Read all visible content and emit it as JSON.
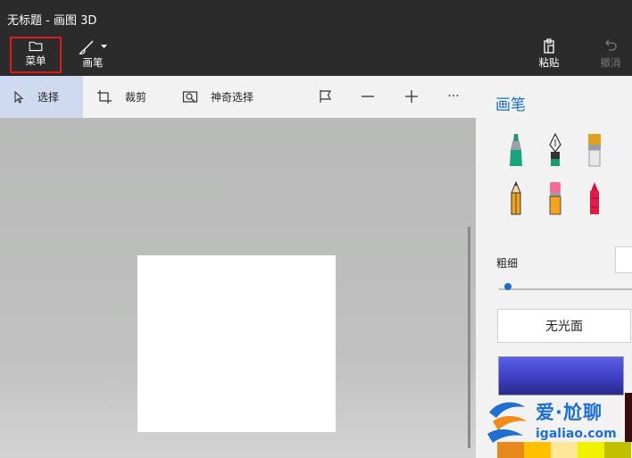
{
  "window": {
    "title": "无标题 - 画图 3D"
  },
  "ribbon": {
    "menu_label": "菜单",
    "brushes_label": "画笔",
    "paste_label": "粘贴",
    "undo_label": "撤消"
  },
  "toolbar": {
    "select_label": "选择",
    "crop_label": "裁剪",
    "magic_select_label": "神奇选择",
    "more_label": "···"
  },
  "panel": {
    "title": "画笔",
    "brush_icons": [
      "marker-icon",
      "calligraphy-pen-icon",
      "oil-brush-icon",
      "pencil-icon",
      "eraser-icon",
      "crayon-icon"
    ],
    "thickness_label": "粗细",
    "finish_label": "无光面",
    "selected_color": "#4a4fd6",
    "palette_colors": [
      "#e8871a",
      "#ffc000",
      "#ffe79a",
      "#f2f200",
      "#c0c000"
    ]
  },
  "watermark": {
    "text": "爱·尬聊",
    "url": "igaliao.com"
  },
  "colors": {
    "accent": "#1b6fc2",
    "highlight_border": "#e0191b",
    "select_bg": "#cfd9ef"
  }
}
